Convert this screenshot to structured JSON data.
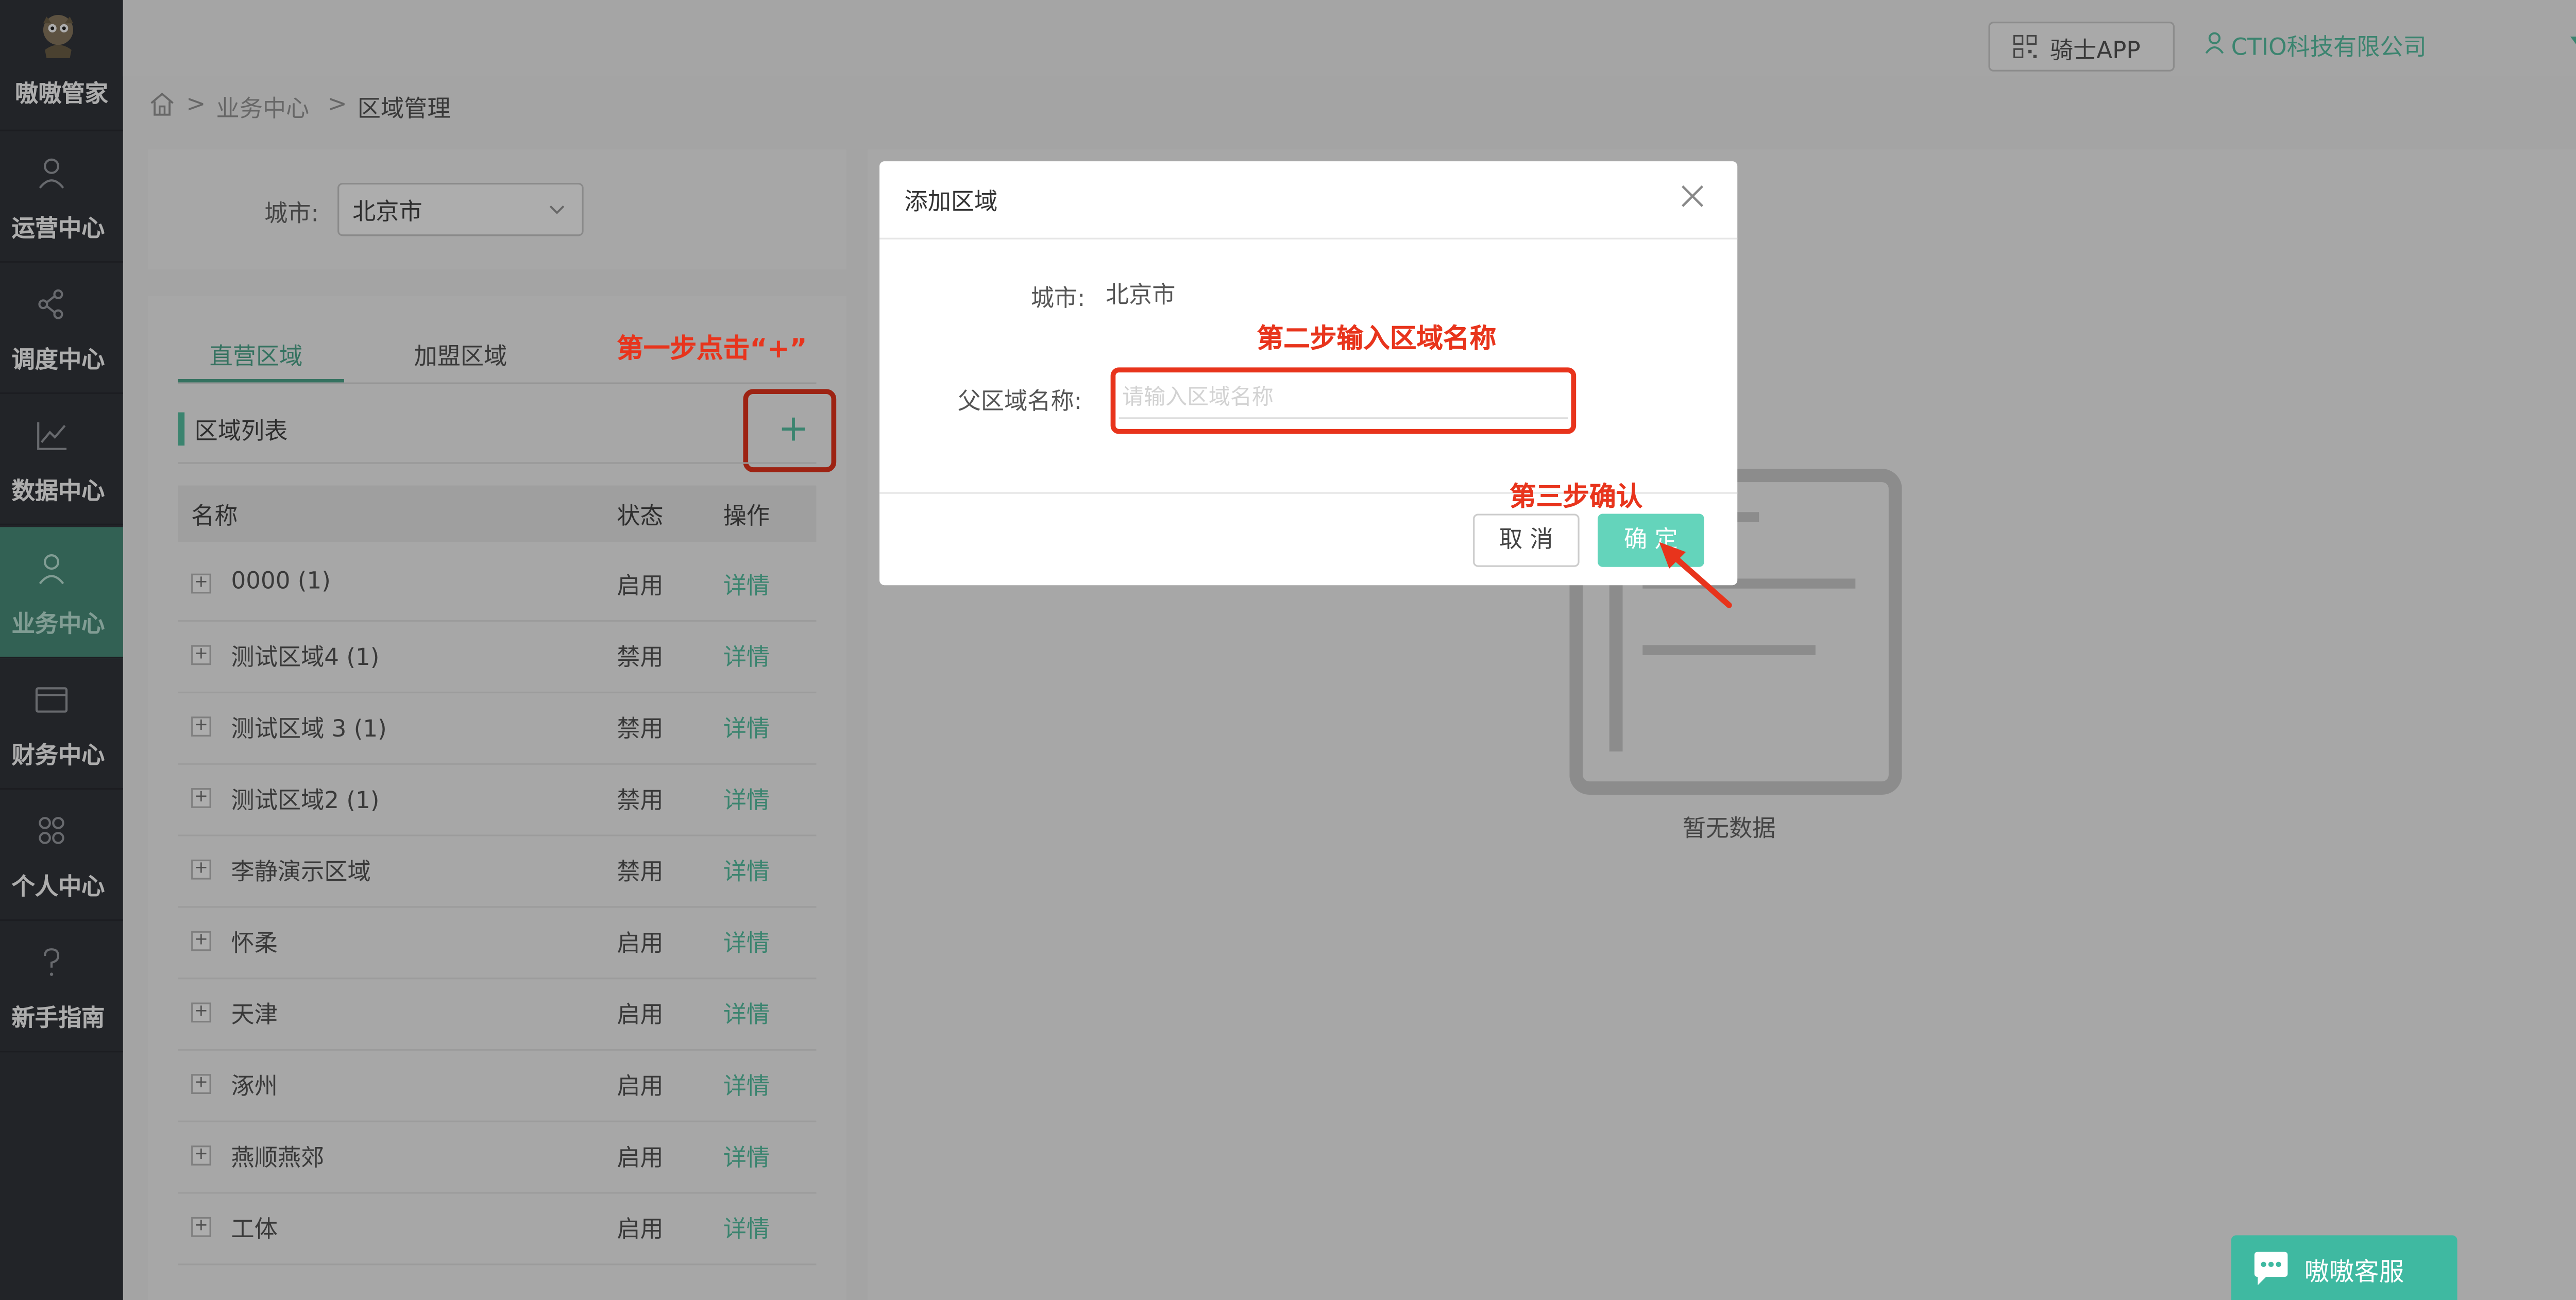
{
  "brand": {
    "name": "嗷嗷管家"
  },
  "sidebar": {
    "items": [
      {
        "label": "运营中心",
        "icon": "user-icon"
      },
      {
        "label": "调度中心",
        "icon": "share-icon"
      },
      {
        "label": "数据中心",
        "icon": "chart-icon"
      },
      {
        "label": "业务中心",
        "icon": "user-icon",
        "active": true
      },
      {
        "label": "财务中心",
        "icon": "card-icon"
      },
      {
        "label": "个人中心",
        "icon": "people-icon"
      },
      {
        "label": "新手指南",
        "icon": "question-icon"
      }
    ]
  },
  "topbar": {
    "app_button": "骑士APP",
    "company": "CTIO科技有限公司"
  },
  "breadcrumb": {
    "sep": ">",
    "items": [
      "业务中心",
      "区域管理"
    ]
  },
  "filter": {
    "city_label": "城市:",
    "city_value": "北京市"
  },
  "tabs": [
    {
      "label": "直营区域",
      "active": true
    },
    {
      "label": "加盟区域"
    }
  ],
  "list": {
    "title": "区域列表",
    "add_symbol": "+",
    "expand_symbol": "+",
    "columns": {
      "name": "名称",
      "status": "状态",
      "action": "操作"
    },
    "rows": [
      {
        "name": "0000 (1)",
        "status": "启用",
        "action": "详情"
      },
      {
        "name": "测试区域4 (1)",
        "status": "禁用",
        "action": "详情"
      },
      {
        "name": "测试区域 3 (1)",
        "status": "禁用",
        "action": "详情"
      },
      {
        "name": "测试区域2 (1)",
        "status": "禁用",
        "action": "详情"
      },
      {
        "name": "李静演示区域",
        "status": "禁用",
        "action": "详情"
      },
      {
        "name": "怀柔",
        "status": "启用",
        "action": "详情"
      },
      {
        "name": "天津",
        "status": "启用",
        "action": "详情"
      },
      {
        "name": "涿州",
        "status": "启用",
        "action": "详情"
      },
      {
        "name": "燕顺燕郊",
        "status": "启用",
        "action": "详情"
      },
      {
        "name": "工体",
        "status": "启用",
        "action": "详情"
      }
    ]
  },
  "empty": {
    "text": "暂无数据"
  },
  "modal": {
    "title": "添加区域",
    "city_label": "城市:",
    "city_value": "北京市",
    "parent_label": "父区域名称:",
    "input_placeholder": "请输入区域名称",
    "input_value": "",
    "cancel": "取 消",
    "ok": "确 定"
  },
  "annotations": {
    "step1": "第一步点击“+”",
    "step2": "第二步输入区域名称",
    "step3": "第三步确认"
  },
  "chat": {
    "label": "嗷嗷客服"
  },
  "colors": {
    "accent": "#58c3a4",
    "annotation": "#e8341c",
    "sidebar_bg": "#33353c"
  }
}
